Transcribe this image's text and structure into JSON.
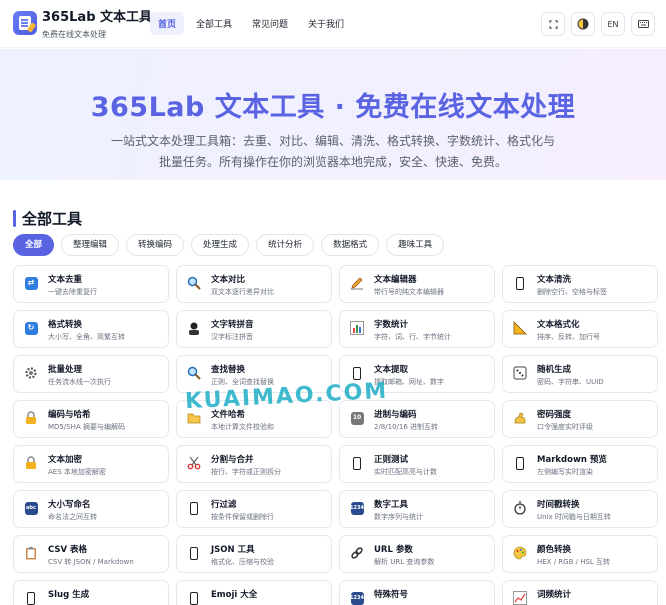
{
  "header": {
    "title": "365Lab 文本工具",
    "subtitle": "免费在线文本处理",
    "nav": [
      {
        "label": "首页",
        "active": true
      },
      {
        "label": "全部工具",
        "active": false
      },
      {
        "label": "常见问题",
        "active": false
      },
      {
        "label": "关于我们",
        "active": false
      }
    ],
    "lang_label": "EN",
    "icons": [
      "fullscreen-icon",
      "theme-toggle-icon",
      "language-button",
      "keyboard-icon"
    ]
  },
  "hero": {
    "title": "365Lab 文本工具 · 免费在线文本处理",
    "description": "一站式文本处理工具箱：去重、对比、编辑、清洗、格式转换、字数统计、格式化与批量任务。所有操作在你的浏览器本地完成，安全、快速、免费。"
  },
  "section": {
    "title": "全部工具",
    "filters": [
      {
        "label": "全部",
        "active": true
      },
      {
        "label": "整理编辑",
        "active": false
      },
      {
        "label": "转换编码",
        "active": false
      },
      {
        "label": "处理生成",
        "active": false
      },
      {
        "label": "统计分析",
        "active": false
      },
      {
        "label": "数据格式",
        "active": false
      },
      {
        "label": "趣味工具",
        "active": false
      }
    ]
  },
  "tools": [
    {
      "title": "文本去重",
      "desc": "一键去除重复行",
      "icon": "repeat-icon"
    },
    {
      "title": "文本对比",
      "desc": "双文本逐行差异对比",
      "icon": "magnifier-icon"
    },
    {
      "title": "文本编辑器",
      "desc": "带行号的纯文本编辑器",
      "icon": "pencil-icon"
    },
    {
      "title": "文本清洗",
      "desc": "删除空行、空格与标签",
      "icon": "phone-icon"
    },
    {
      "title": "格式转换",
      "desc": "大小写、全角、简繁互转",
      "icon": "refresh-icon"
    },
    {
      "title": "文字转拼音",
      "desc": "汉字标注拼音",
      "icon": "person-icon"
    },
    {
      "title": "字数统计",
      "desc": "字符、词、行、字节统计",
      "icon": "bar-chart-icon"
    },
    {
      "title": "文本格式化",
      "desc": "排序、反转、加行号",
      "icon": "ruler-triangle-icon"
    },
    {
      "title": "批量处理",
      "desc": "任务流水线一次执行",
      "icon": "gear-icon"
    },
    {
      "title": "查找替换",
      "desc": "正则、全词查找替换",
      "icon": "search-icon"
    },
    {
      "title": "文本提取",
      "desc": "提取邮箱、网址、数字",
      "icon": "phone-icon"
    },
    {
      "title": "随机生成",
      "desc": "密码、字符串、UUID",
      "icon": "dice-icon"
    },
    {
      "title": "编码与哈希",
      "desc": "MD5/SHA 摘要与编解码",
      "icon": "lock-icon"
    },
    {
      "title": "文件哈希",
      "desc": "本地计算文件校验和",
      "icon": "folder-icon"
    },
    {
      "title": "进制与编码",
      "desc": "2/8/10/16 进制互转",
      "icon": "number-icon"
    },
    {
      "title": "密码强度",
      "desc": "口令强度实时评级",
      "icon": "muscle-icon"
    },
    {
      "title": "文本加密",
      "desc": "AES 本地加密解密",
      "icon": "lock-icon"
    },
    {
      "title": "分割与合并",
      "desc": "按行、字符或正则拆分",
      "icon": "scissors-icon"
    },
    {
      "title": "正则测试",
      "desc": "实时匹配高亮与计数",
      "icon": "phone-icon"
    },
    {
      "title": "Markdown 预览",
      "desc": "左侧编写实时渲染",
      "icon": "phone-icon"
    },
    {
      "title": "大小写命名",
      "desc": "命名法之间互转",
      "icon": "abc-icon"
    },
    {
      "title": "行过滤",
      "desc": "按条件保留或删除行",
      "icon": "phone-icon"
    },
    {
      "title": "数字工具",
      "desc": "数字序列与统计",
      "icon": "numbers-icon"
    },
    {
      "title": "时间戳转换",
      "desc": "Unix 时间戳与日期互转",
      "icon": "stopwatch-icon"
    },
    {
      "title": "CSV 表格",
      "desc": "CSV 转 JSON / Markdown",
      "icon": "clipboard-icon"
    },
    {
      "title": "JSON 工具",
      "desc": "格式化、压缩与校验",
      "icon": "phone-icon"
    },
    {
      "title": "URL 参数",
      "desc": "解析 URL 查询参数",
      "icon": "link-icon"
    },
    {
      "title": "颜色转换",
      "desc": "HEX / RGB / HSL 互转",
      "icon": "palette-icon"
    },
    {
      "title": "Slug 生成",
      "desc": "",
      "icon": "phone-icon"
    },
    {
      "title": "Emoji 大全",
      "desc": "",
      "icon": "phone-icon"
    },
    {
      "title": "特殊符号",
      "desc": "",
      "icon": "numbers-icon"
    },
    {
      "title": "词频统计",
      "desc": "",
      "icon": "chart-up-icon"
    }
  ],
  "watermark": "KUAIMAO.COM"
}
